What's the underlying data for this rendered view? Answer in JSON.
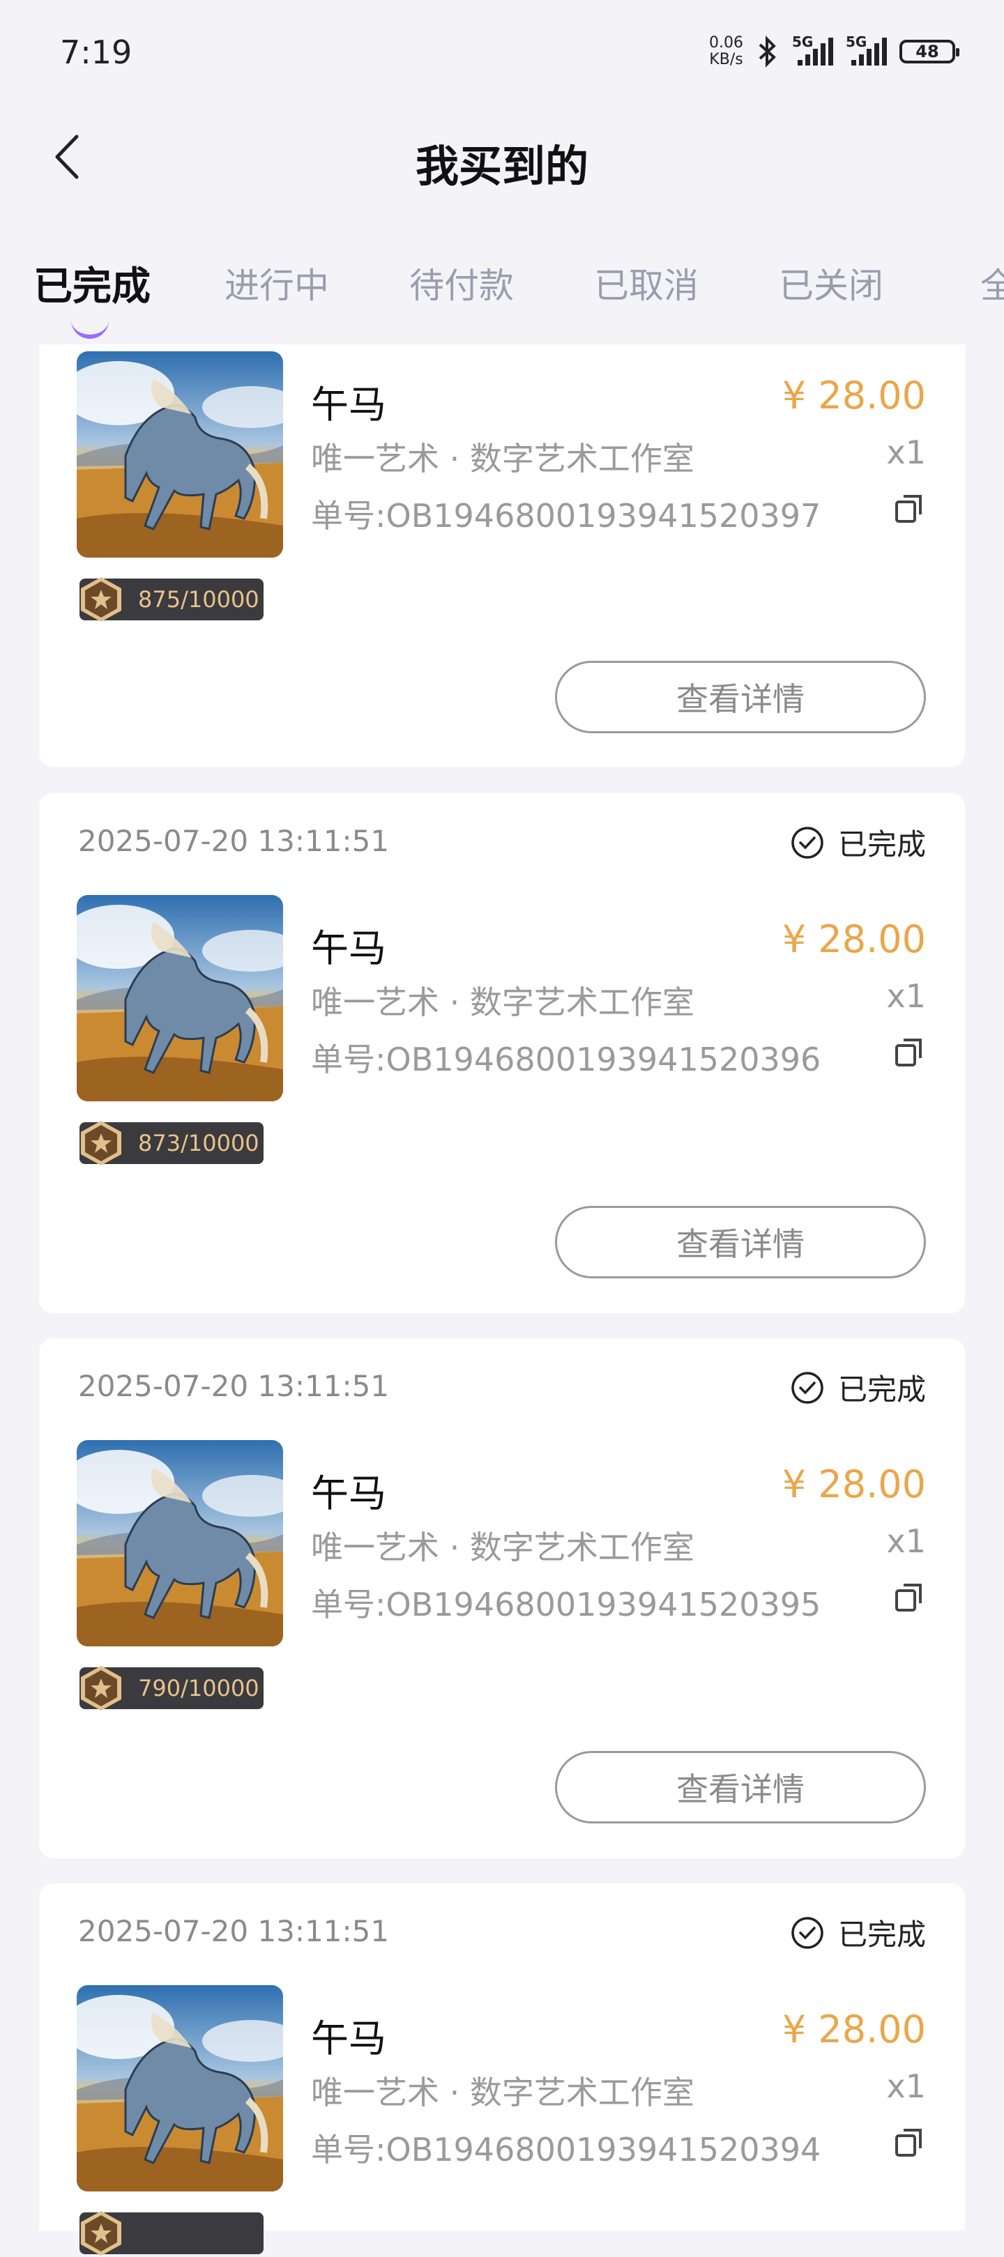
{
  "status_bar": {
    "time": "7:19",
    "net_speed_value": "0.06",
    "net_speed_unit": "KB/s",
    "network1": "5G",
    "network2": "5G",
    "battery": "48"
  },
  "header": {
    "title": "我买到的"
  },
  "tabs": [
    {
      "label": "已完成",
      "active": true
    },
    {
      "label": "进行中",
      "active": false
    },
    {
      "label": "待付款",
      "active": false
    },
    {
      "label": "已取消",
      "active": false
    },
    {
      "label": "已关闭",
      "active": false
    },
    {
      "label": "全",
      "active": false
    }
  ],
  "orders": [
    {
      "date": "",
      "status": "",
      "name": "午马",
      "price": "¥ 28.00",
      "shop": "唯一艺术 · 数字艺术工作室",
      "qty": "x1",
      "order_no": "单号:OB1946800193941520397",
      "serial": "875/10000",
      "button": "查看详情"
    },
    {
      "date": "2025-07-20 13:11:51",
      "status": "已完成",
      "name": "午马",
      "price": "¥ 28.00",
      "shop": "唯一艺术 · 数字艺术工作室",
      "qty": "x1",
      "order_no": "单号:OB1946800193941520396",
      "serial": "873/10000",
      "button": "查看详情"
    },
    {
      "date": "2025-07-20 13:11:51",
      "status": "已完成",
      "name": "午马",
      "price": "¥ 28.00",
      "shop": "唯一艺术 · 数字艺术工作室",
      "qty": "x1",
      "order_no": "单号:OB1946800193941520395",
      "serial": "790/10000",
      "button": "查看详情"
    },
    {
      "date": "2025-07-20 13:11:51",
      "status": "已完成",
      "name": "午马",
      "price": "¥ 28.00",
      "shop": "唯一艺术 · 数字艺术工作室",
      "qty": "x1",
      "order_no": "单号:OB1946800193941520394",
      "serial": "",
      "button": ""
    }
  ],
  "colors": {
    "price": "#e9a74a",
    "tab_indicator": "#9b6bff",
    "badge_bg": "#3b3b3f"
  }
}
